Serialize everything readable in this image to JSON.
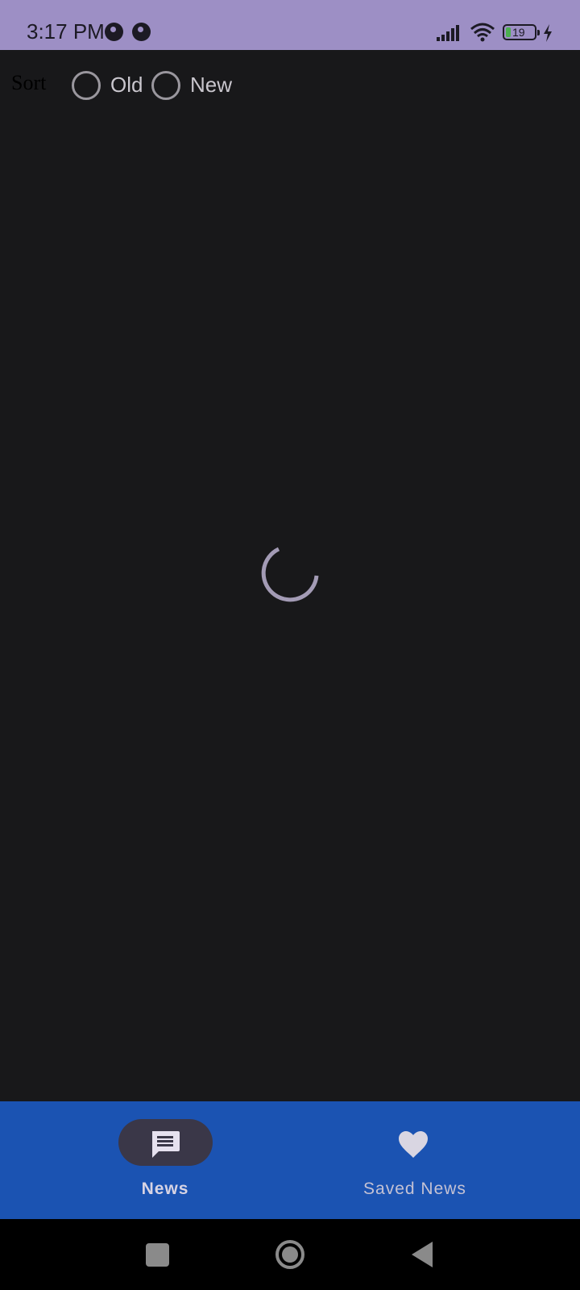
{
  "status_bar": {
    "time": "3:17 PM",
    "battery_level": "19",
    "icons": [
      "app-notification-icon",
      "app-notification-icon",
      "signal-icon",
      "wifi-icon",
      "battery-icon",
      "charging-icon"
    ]
  },
  "sort": {
    "label": "Sort",
    "options": [
      {
        "label": "Old",
        "selected": false
      },
      {
        "label": "New",
        "selected": false
      }
    ]
  },
  "loading": {
    "icon": "spinner-icon"
  },
  "bottom_nav": {
    "items": [
      {
        "label": "News",
        "icon": "chat-icon",
        "selected": true
      },
      {
        "label": "Saved News",
        "icon": "heart-icon",
        "selected": false
      }
    ]
  },
  "system_nav": {
    "icons": [
      "recents-icon",
      "home-icon",
      "back-icon"
    ]
  },
  "colors": {
    "status_bar": "#9d8fc5",
    "background": "#18181a",
    "bottom_nav": "#1b53b2",
    "nav_indicator": "#3a3748",
    "spinner": "#a39bb5"
  }
}
